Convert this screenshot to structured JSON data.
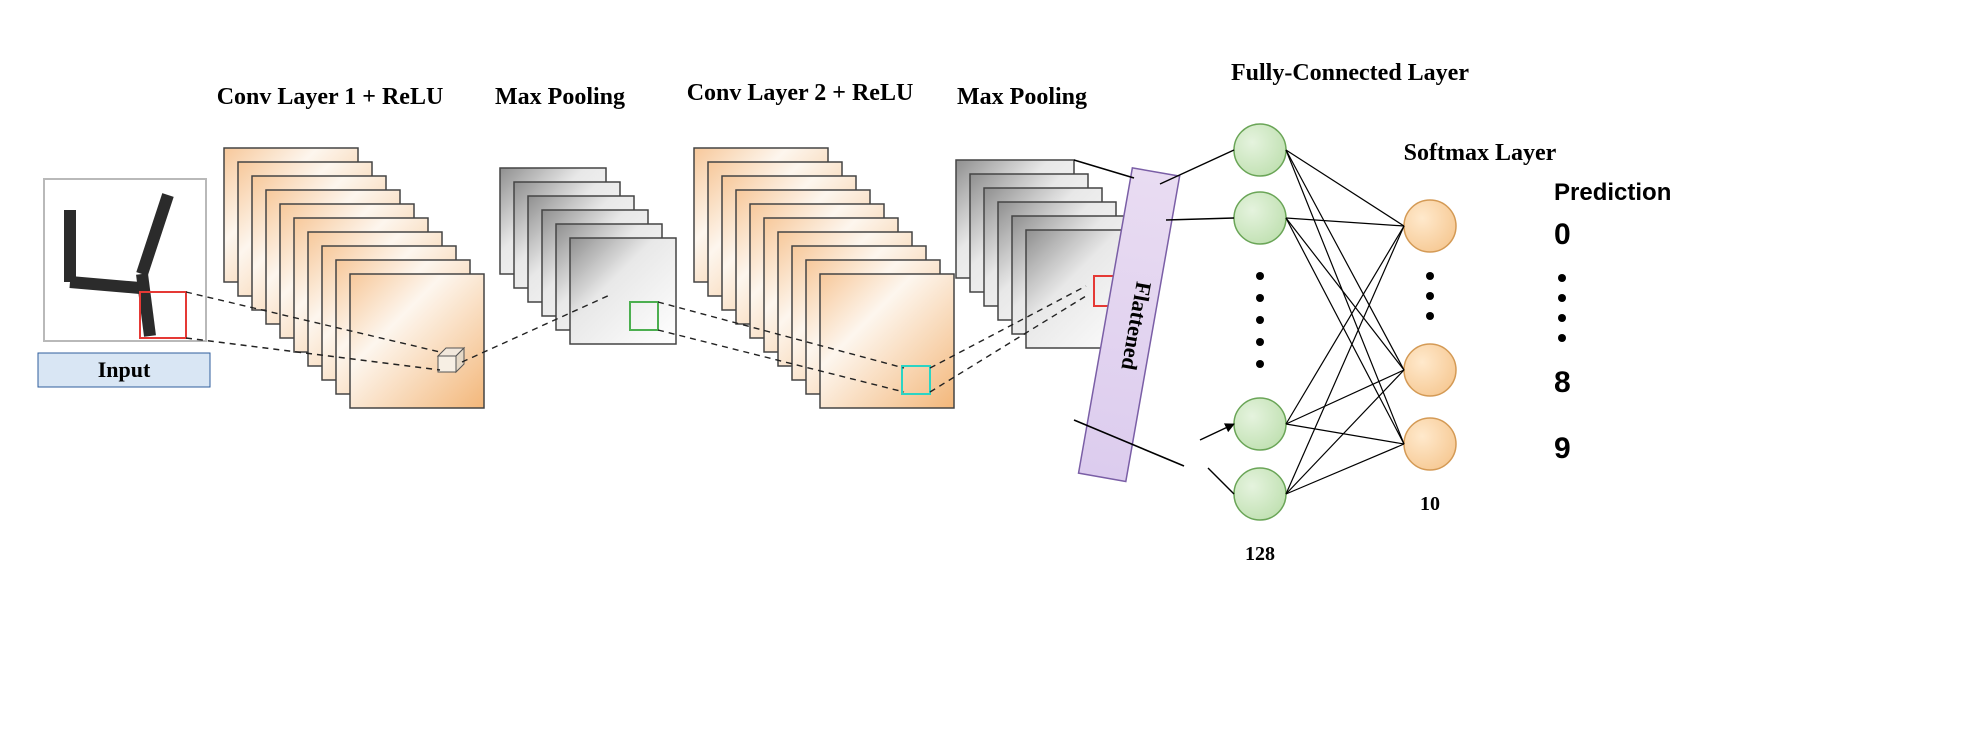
{
  "input_label": "Input",
  "conv1_label": "Conv Layer 1 + ReLU",
  "maxpool1_label": "Max Pooling",
  "conv2_label": "Conv Layer 2 + ReLU",
  "maxpool2_label": "Max Pooling",
  "flattened_label": "Flattened",
  "fc_label": "Fully-Connected Layer",
  "softmax_label": "Softmax Layer",
  "prediction_label": "Prediction",
  "fc_count_label": "128",
  "softmax_count_label": "10",
  "predictions": {
    "p0": "0",
    "p1": "8",
    "p2": "9"
  }
}
